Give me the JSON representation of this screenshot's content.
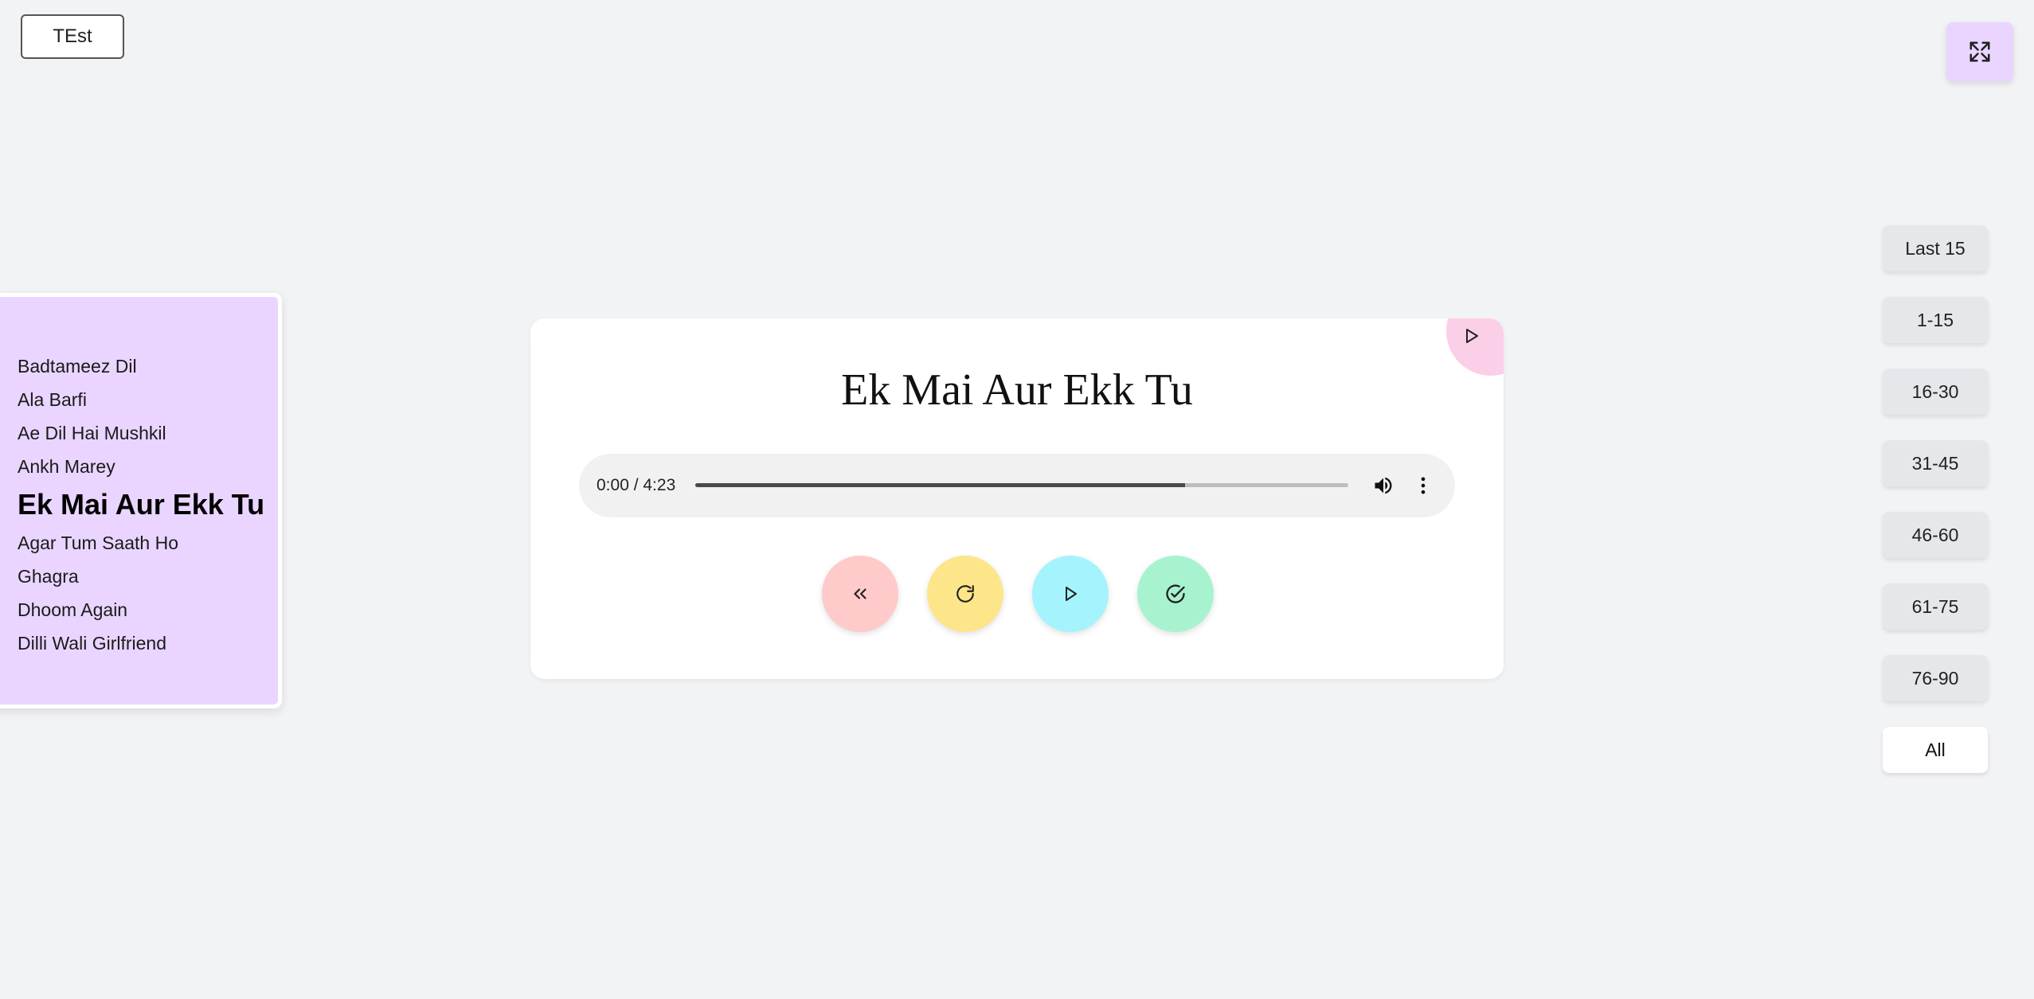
{
  "header": {
    "test_button_label": "TEst",
    "fullscreen_icon": "expand-icon"
  },
  "song_list": {
    "items": [
      {
        "label": "Badtameez Dil",
        "active": false
      },
      {
        "label": "Ala Barfi",
        "active": false
      },
      {
        "label": "Ae Dil Hai Mushkil",
        "active": false
      },
      {
        "label": "Ankh Marey",
        "active": false
      },
      {
        "label": "Ek Mai Aur Ekk Tu",
        "active": true
      },
      {
        "label": "Agar Tum Saath Ho",
        "active": false
      },
      {
        "label": "Ghagra",
        "active": false
      },
      {
        "label": "Dhoom Again",
        "active": false
      },
      {
        "label": "Dilli Wali Girlfriend",
        "active": false
      }
    ]
  },
  "player": {
    "title": "Ek Mai Aur Ekk Tu",
    "time_display": "0:00 / 4:23",
    "progress_fraction": 0.75,
    "controls": [
      {
        "name": "back",
        "icon": "double-chevron-left-icon",
        "color": "#fecaca"
      },
      {
        "name": "replay",
        "icon": "rotate-cw-icon",
        "color": "#fde68a"
      },
      {
        "name": "play",
        "icon": "play-icon",
        "color": "#a5f3fc"
      },
      {
        "name": "done",
        "icon": "check-circle-icon",
        "color": "#a7f3d0"
      }
    ],
    "corner_icon": "play-icon"
  },
  "ranges": {
    "buttons": [
      "Last 15",
      "1-15",
      "16-30",
      "31-45",
      "46-60",
      "61-75",
      "76-90",
      "All"
    ],
    "selected": "All"
  },
  "colors": {
    "background": "#f2f3f5",
    "list_bg": "#e9d5ff",
    "corner_pink": "#fbcfe8"
  }
}
